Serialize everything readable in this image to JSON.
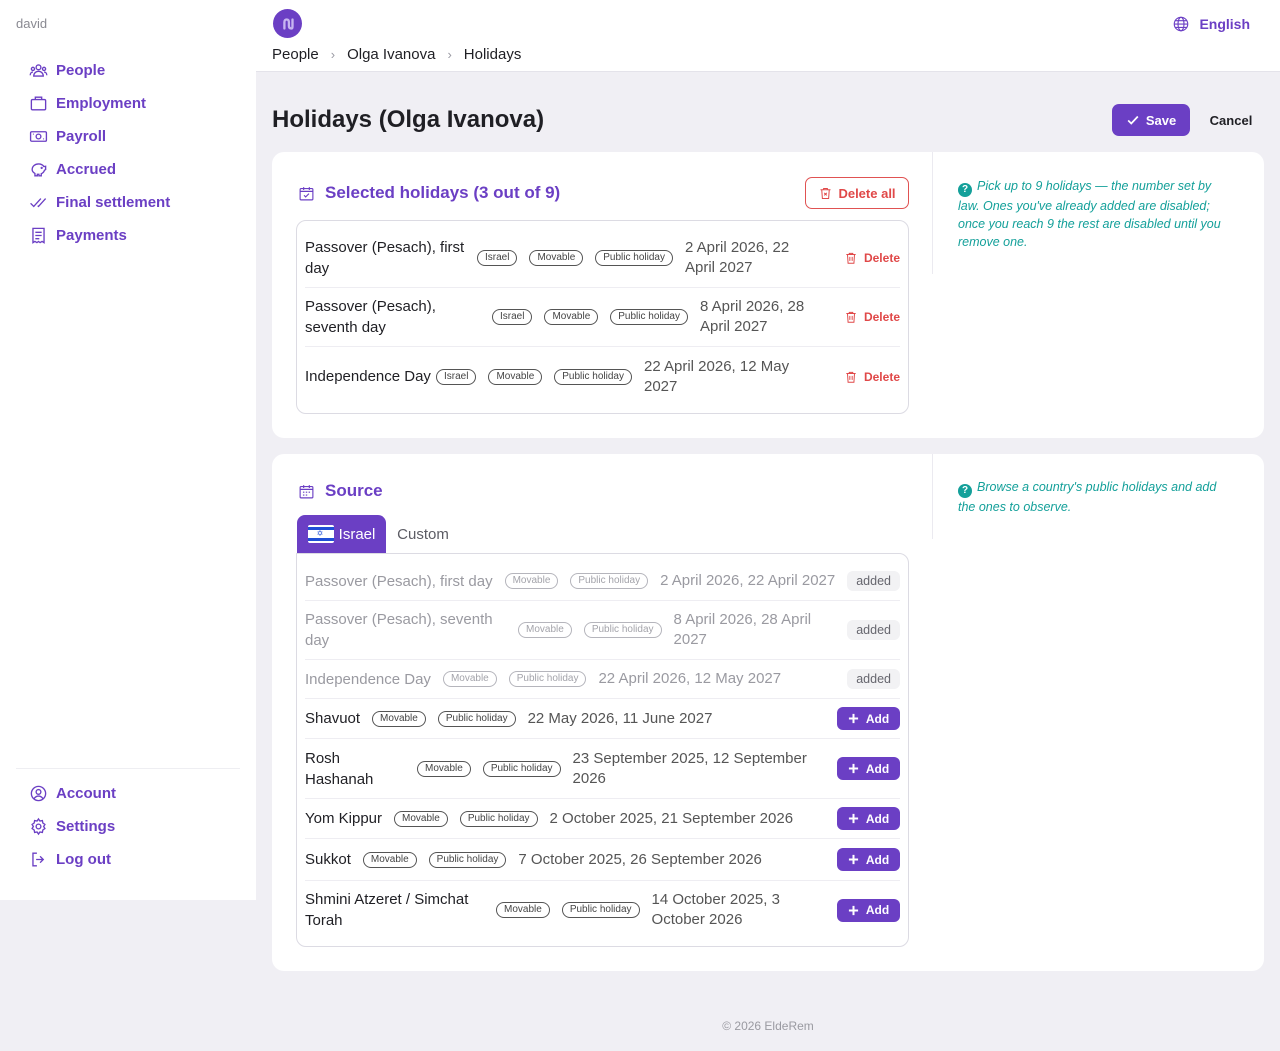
{
  "user": "david",
  "nav": [
    {
      "key": "people",
      "label": "People",
      "icon": "people-icon"
    },
    {
      "key": "employment",
      "label": "Employment",
      "icon": "briefcase-icon"
    },
    {
      "key": "payroll",
      "label": "Payroll",
      "icon": "banknote-icon"
    },
    {
      "key": "accrued",
      "label": "Accrued",
      "icon": "piggy-bank-icon"
    },
    {
      "key": "final",
      "label": "Final settlement",
      "icon": "double-check-icon"
    },
    {
      "key": "payments",
      "label": "Payments",
      "icon": "receipt-icon"
    }
  ],
  "nav_bottom": [
    {
      "key": "account",
      "label": "Account",
      "icon": "user-circle-icon"
    },
    {
      "key": "settings",
      "label": "Settings",
      "icon": "gear-icon"
    },
    {
      "key": "logout",
      "label": "Log out",
      "icon": "logout-icon"
    }
  ],
  "header": {
    "breadcrumb": [
      "People",
      "Olga Ivanova",
      "Holidays"
    ],
    "language": "English"
  },
  "page": {
    "title": "Holidays (Olga Ivanova)",
    "save_label": "Save",
    "cancel_label": "Cancel"
  },
  "selected": {
    "title": "Selected holidays (3 out of 9)",
    "delete_all_label": "Delete all",
    "delete_label": "Delete",
    "hint": "Pick up to 9 holidays — the number set by law. Ones you've already added are disabled; once you reach 9 the rest are disabled until you remove one.",
    "items": [
      {
        "name": "Passover (Pesach), first day",
        "tags": [
          "Israel",
          "Movable",
          "Public holiday"
        ],
        "dates": "2 April 2026, 22 April 2027"
      },
      {
        "name": "Passover (Pesach), seventh day",
        "tags": [
          "Israel",
          "Movable",
          "Public holiday"
        ],
        "dates": "8 April 2026, 28 April 2027"
      },
      {
        "name": "Independence Day",
        "tags": [
          "Israel",
          "Movable",
          "Public holiday"
        ],
        "dates": "22 April 2026, 12 May 2027"
      }
    ]
  },
  "source": {
    "title": "Source",
    "hint": "Browse a country's public holidays and add the ones to observe.",
    "tabs": [
      "Israel",
      "Custom"
    ],
    "added_label": "added",
    "add_label": "Add",
    "items": [
      {
        "name": "Passover (Pesach), first day",
        "tags": [
          "Movable",
          "Public holiday"
        ],
        "dates": "2 April 2026, 22 April 2027",
        "added": true
      },
      {
        "name": "Passover (Pesach), seventh day",
        "tags": [
          "Movable",
          "Public holiday"
        ],
        "dates": "8 April 2026, 28 April 2027",
        "added": true
      },
      {
        "name": "Independence Day",
        "tags": [
          "Movable",
          "Public holiday"
        ],
        "dates": "22 April 2026, 12 May 2027",
        "added": true
      },
      {
        "name": "Shavuot",
        "tags": [
          "Movable",
          "Public holiday"
        ],
        "dates": "22 May 2026, 11 June 2027",
        "added": false
      },
      {
        "name": "Rosh Hashanah",
        "tags": [
          "Movable",
          "Public holiday"
        ],
        "dates": "23 September 2025, 12 September 2026",
        "added": false
      },
      {
        "name": "Yom Kippur",
        "tags": [
          "Movable",
          "Public holiday"
        ],
        "dates": "2 October 2025, 21 September 2026",
        "added": false
      },
      {
        "name": "Sukkot",
        "tags": [
          "Movable",
          "Public holiday"
        ],
        "dates": "7 October 2025, 26 September 2026",
        "added": false
      },
      {
        "name": "Shmini Atzeret / Simchat Torah",
        "tags": [
          "Movable",
          "Public holiday"
        ],
        "dates": "14 October 2025, 3 October 2026",
        "added": false
      }
    ]
  },
  "footer": "© 2026 EldeRem",
  "colors": {
    "accent": "#6b3fc4",
    "danger": "#e04848",
    "hint": "#14a09a"
  }
}
